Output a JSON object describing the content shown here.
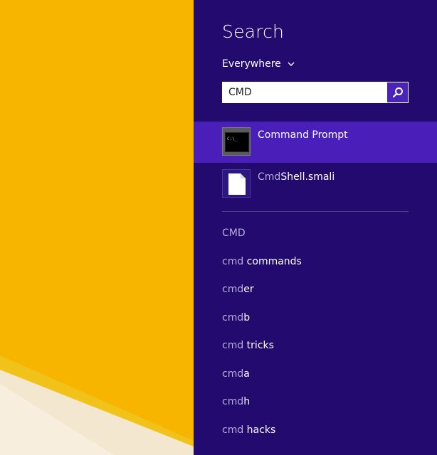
{
  "search": {
    "title": "Search",
    "scope_label": "Everywhere",
    "query": "CMD"
  },
  "results": [
    {
      "name": "Command Prompt",
      "match": "",
      "rest": "Command Prompt",
      "icon": "command-prompt-icon"
    },
    {
      "name": "CmdShell.smali",
      "match": "Cmd",
      "rest": "Shell.smali",
      "icon": "file-icon"
    }
  ],
  "suggestions": [
    {
      "match": "CMD",
      "rest": ""
    },
    {
      "match": "cmd",
      "rest": " commands"
    },
    {
      "match": "cmd",
      "rest": "er"
    },
    {
      "match": "cmd",
      "rest": "b"
    },
    {
      "match": "cmd",
      "rest": " tricks"
    },
    {
      "match": "cmd",
      "rest": "a"
    },
    {
      "match": "cmd",
      "rest": "h"
    },
    {
      "match": "cmd",
      "rest": " hacks"
    }
  ],
  "colors": {
    "panel_bg": "#220A6E",
    "selected_bg": "#4A1EB8",
    "search_button_bg": "#4A24B8",
    "desktop_yellow": "#F7B500",
    "dim_text": "#B6AEDB"
  }
}
